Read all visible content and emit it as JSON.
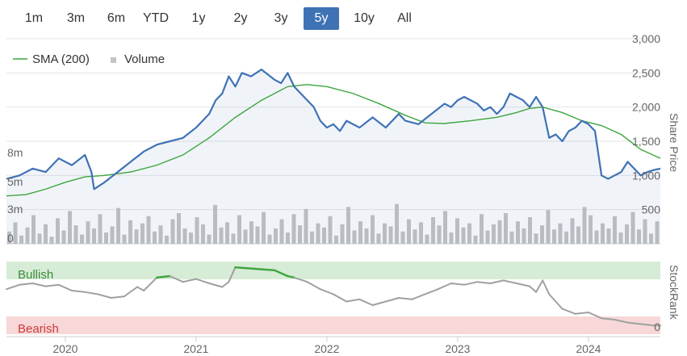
{
  "range_selector": {
    "buttons": [
      "1m",
      "3m",
      "6m",
      "YTD",
      "1y",
      "2y",
      "3y",
      "5y",
      "10y",
      "All"
    ],
    "selected": "5y"
  },
  "legend": {
    "sma_label": "SMA (200)",
    "volume_label": "Volume"
  },
  "colors": {
    "price": "#3f72b5",
    "sma": "#3da53d",
    "volume": "#c4c4c4",
    "stockrank": "#a0a0a0",
    "bullish_band": "#d6ecd6",
    "bearish_band": "#f7d7d7",
    "bullish_text": "#3c8a3c",
    "bearish_text": "#cc3b3b",
    "selected_button": "#3f72b5"
  },
  "chart_data": [
    {
      "type": "line",
      "ylabel": "Share Price",
      "ylim": [
        0,
        3000
      ],
      "yticks": [
        "500",
        "1,000",
        "1,500",
        "2,000",
        "2,500",
        "3,000"
      ],
      "xticks": [
        "2020",
        "2021",
        "2022",
        "2023",
        "2024"
      ],
      "series": [
        {
          "name": "Share Price",
          "x": [
            2019.55,
            2019.65,
            2019.75,
            2019.85,
            2019.95,
            2020.05,
            2020.15,
            2020.2,
            2020.22,
            2020.3,
            2020.4,
            2020.5,
            2020.6,
            2020.7,
            2020.8,
            2020.9,
            2021.0,
            2021.1,
            2021.15,
            2021.2,
            2021.25,
            2021.3,
            2021.35,
            2021.42,
            2021.5,
            2021.6,
            2021.65,
            2021.7,
            2021.75,
            2021.8,
            2021.9,
            2021.95,
            2022.0,
            2022.05,
            2022.1,
            2022.15,
            2022.25,
            2022.35,
            2022.45,
            2022.55,
            2022.6,
            2022.7,
            2022.8,
            2022.9,
            2022.95,
            2023.0,
            2023.05,
            2023.15,
            2023.2,
            2023.25,
            2023.3,
            2023.35,
            2023.4,
            2023.45,
            2023.5,
            2023.55,
            2023.6,
            2023.65,
            2023.7,
            2023.75,
            2023.8,
            2023.85,
            2023.9,
            2023.95,
            2024.0,
            2024.05,
            2024.1,
            2024.15,
            2024.2,
            2024.25,
            2024.3,
            2024.35,
            2024.4,
            2024.45,
            2024.5,
            2024.55
          ],
          "values": [
            950,
            1000,
            1100,
            1050,
            1250,
            1150,
            1300,
            1050,
            800,
            900,
            1050,
            1200,
            1350,
            1450,
            1500,
            1550,
            1700,
            1900,
            2100,
            2200,
            2450,
            2300,
            2500,
            2450,
            2550,
            2400,
            2350,
            2500,
            2300,
            2200,
            2000,
            1800,
            1700,
            1750,
            1650,
            1800,
            1700,
            1850,
            1700,
            1900,
            1800,
            1750,
            1900,
            2050,
            2000,
            2100,
            2150,
            2050,
            1950,
            2000,
            1900,
            2000,
            2200,
            2150,
            2100,
            2000,
            2150,
            2000,
            1550,
            1600,
            1500,
            1650,
            1700,
            1800,
            1750,
            1650,
            1000,
            950,
            1000,
            1050,
            1200,
            1100,
            1000,
            1050,
            1080,
            1100
          ]
        },
        {
          "name": "SMA (200)",
          "x": [
            2019.55,
            2019.7,
            2019.85,
            2020.0,
            2020.15,
            2020.3,
            2020.5,
            2020.7,
            2020.9,
            2021.1,
            2021.3,
            2021.5,
            2021.7,
            2021.85,
            2022.0,
            2022.2,
            2022.4,
            2022.6,
            2022.75,
            2022.9,
            2023.1,
            2023.3,
            2023.45,
            2023.55,
            2023.65,
            2023.8,
            2023.95,
            2024.1,
            2024.25,
            2024.4,
            2024.55
          ],
          "values": [
            700,
            720,
            800,
            900,
            980,
            1000,
            1050,
            1150,
            1300,
            1550,
            1850,
            2100,
            2300,
            2330,
            2300,
            2200,
            2050,
            1880,
            1770,
            1760,
            1800,
            1850,
            1920,
            1980,
            2000,
            1920,
            1800,
            1730,
            1600,
            1380,
            1250
          ]
        }
      ]
    },
    {
      "type": "bar",
      "ylabel": "Volume",
      "yticks": [
        "0",
        "3m",
        "5m",
        "8m"
      ],
      "values": [
        1.2,
        2.1,
        0.8,
        1.6,
        2.8,
        1.0,
        1.9,
        0.7,
        2.5,
        1.3,
        3.2,
        1.8,
        0.9,
        2.2,
        1.5,
        2.9,
        1.1,
        1.7,
        3.5,
        0.9,
        2.3,
        1.4,
        2.0,
        2.7,
        1.2,
        1.8,
        0.8,
        2.4,
        3.0,
        1.5,
        1.1,
        2.6,
        1.9,
        0.9,
        3.8,
        1.6,
        2.1,
        1.0,
        2.8,
        1.4,
        2.2,
        1.7,
        3.1,
        0.9,
        1.5,
        2.4,
        1.1,
        2.9,
        1.8,
        3.4,
        1.2,
        2.0,
        1.6,
        2.7,
        0.8,
        1.9,
        3.6,
        1.3,
        2.2,
        1.5,
        2.8,
        1.0,
        2.0,
        1.7,
        3.9,
        1.2,
        2.4,
        1.4,
        2.1,
        0.9,
        2.6,
        1.8,
        3.2,
        1.1,
        2.5,
        1.6,
        2.0,
        0.8,
        2.9,
        1.3,
        1.9,
        2.3,
        3.0,
        1.2,
        2.2,
        1.5,
        2.6,
        1.0,
        1.8,
        3.3,
        1.4,
        2.0,
        1.2,
        2.5,
        1.7,
        3.6,
        2.8,
        1.3,
        2.0,
        1.5,
        2.7,
        1.1,
        1.9,
        3.1,
        1.4,
        2.4,
        1.0,
        2.2
      ]
    },
    {
      "type": "line",
      "ylabel": "StockRank",
      "ylim": [
        0,
        100
      ],
      "yticks": [
        "0"
      ],
      "annotations": [
        "Bullish",
        "Bearish"
      ],
      "series": [
        {
          "name": "StockRank",
          "x": [
            2019.55,
            2019.65,
            2019.75,
            2019.85,
            2019.95,
            2020.05,
            2020.15,
            2020.25,
            2020.35,
            2020.45,
            2020.55,
            2020.6,
            2020.7,
            2020.8,
            2020.9,
            2021.0,
            2021.1,
            2021.2,
            2021.25,
            2021.3,
            2021.45,
            2021.6,
            2021.7,
            2021.75,
            2021.85,
            2021.95,
            2022.05,
            2022.15,
            2022.25,
            2022.35,
            2022.45,
            2022.55,
            2022.65,
            2022.75,
            2022.85,
            2022.95,
            2023.05,
            2023.15,
            2023.25,
            2023.35,
            2023.45,
            2023.55,
            2023.6,
            2023.65,
            2023.7,
            2023.8,
            2023.9,
            2024.0,
            2024.1,
            2024.2,
            2024.3,
            2024.4,
            2024.5,
            2024.55
          ],
          "values": [
            62,
            68,
            70,
            66,
            68,
            60,
            58,
            55,
            50,
            52,
            65,
            60,
            78,
            80,
            72,
            76,
            70,
            65,
            72,
            92,
            90,
            88,
            80,
            78,
            72,
            62,
            55,
            45,
            48,
            40,
            45,
            50,
            48,
            55,
            62,
            70,
            68,
            72,
            70,
            74,
            70,
            66,
            58,
            74,
            55,
            35,
            28,
            30,
            22,
            20,
            16,
            14,
            12,
            12
          ]
        }
      ]
    }
  ]
}
